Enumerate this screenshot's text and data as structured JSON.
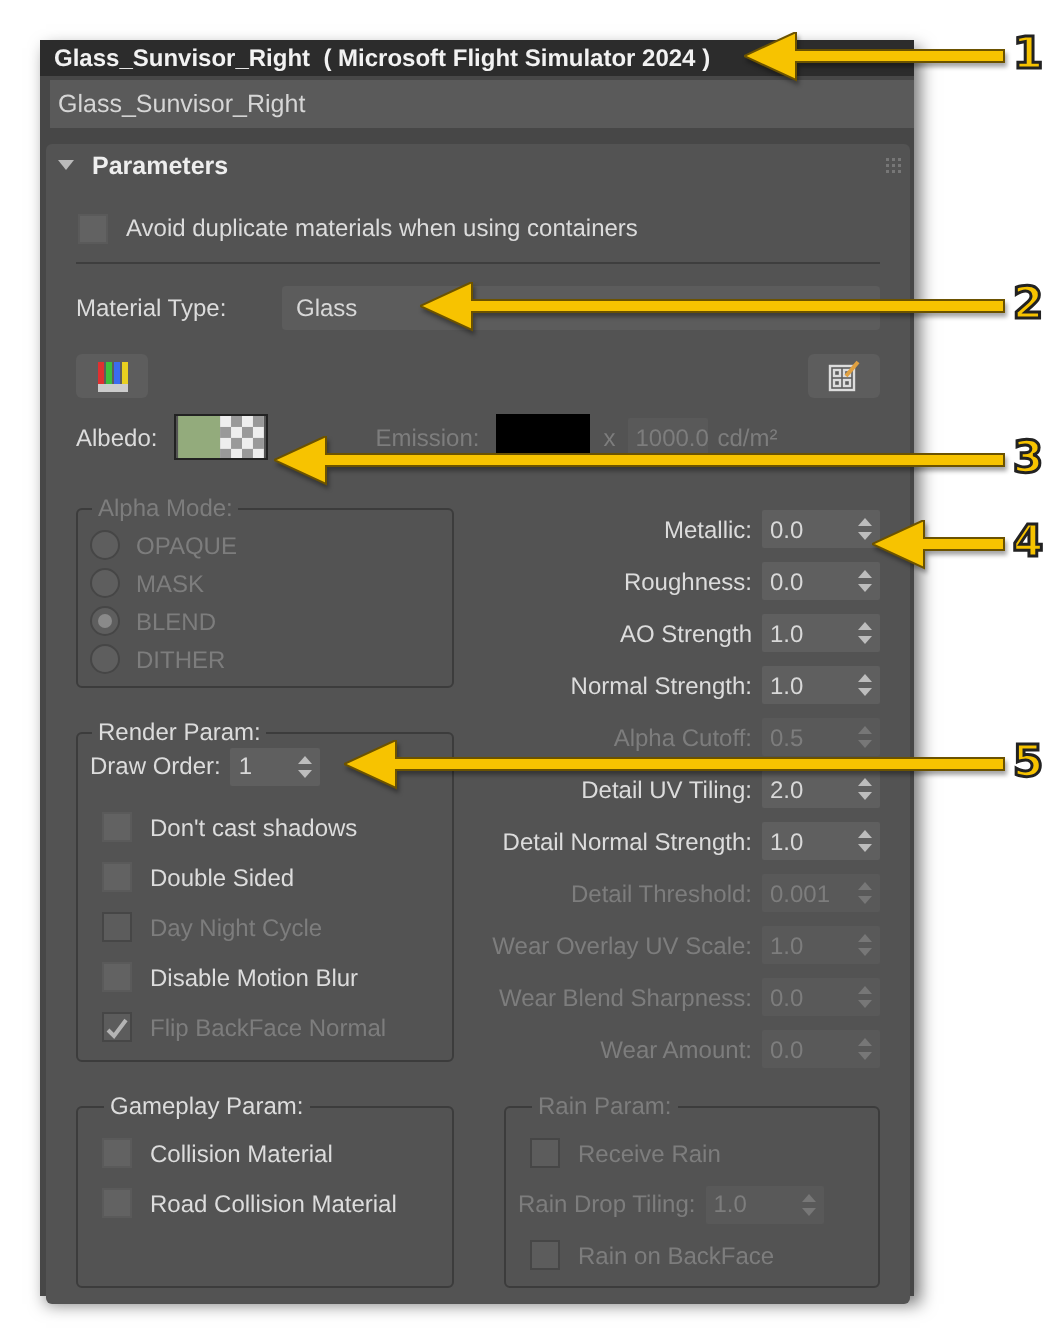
{
  "window": {
    "title": "Glass_Sunvisor_Right  ( Microsoft Flight Simulator 2024 )"
  },
  "name_field": {
    "value": "Glass_Sunvisor_Right"
  },
  "rollout": {
    "title": "Parameters",
    "expanded": true
  },
  "avoid_duplicates": {
    "label": "Avoid duplicate materials when using containers",
    "checked": false
  },
  "material_type": {
    "label": "Material Type:",
    "value": "Glass"
  },
  "albedo": {
    "label": "Albedo:"
  },
  "emission": {
    "label": "Emission:",
    "multiplier": "x",
    "value": "1000.0",
    "unit": "cd/m²",
    "disabled": true
  },
  "alpha_mode": {
    "label": "Alpha Mode:",
    "disabled": true,
    "options": [
      {
        "label": "OPAQUE",
        "selected": false
      },
      {
        "label": "MASK",
        "selected": false
      },
      {
        "label": "BLEND",
        "selected": true
      },
      {
        "label": "DITHER",
        "selected": false
      }
    ]
  },
  "render_param": {
    "label": "Render Param:",
    "draw_order": {
      "label": "Draw Order:",
      "value": "1"
    },
    "options": [
      {
        "label": "Don't cast shadows",
        "checked": false,
        "disabled": false
      },
      {
        "label": "Double Sided",
        "checked": false,
        "disabled": false
      },
      {
        "label": "Day Night Cycle",
        "checked": false,
        "disabled": true
      },
      {
        "label": "Disable Motion Blur",
        "checked": false,
        "disabled": false
      },
      {
        "label": "Flip BackFace Normal",
        "checked": true,
        "disabled": true
      }
    ]
  },
  "properties": [
    {
      "label": "Metallic:",
      "value": "0.0",
      "disabled": false
    },
    {
      "label": "Roughness:",
      "value": "0.0",
      "disabled": false
    },
    {
      "label": "AO Strength",
      "value": "1.0",
      "disabled": false
    },
    {
      "label": "Normal Strength:",
      "value": "1.0",
      "disabled": false
    },
    {
      "label": "Alpha Cutoff:",
      "value": "0.5",
      "disabled": true
    },
    {
      "label": "Detail UV Tiling:",
      "value": "2.0",
      "disabled": false
    },
    {
      "label": "Detail Normal Strength:",
      "value": "1.0",
      "disabled": false
    },
    {
      "label": "Detail Threshold:",
      "value": "0.001",
      "disabled": true
    },
    {
      "label": "Wear Overlay UV Scale:",
      "value": "1.0",
      "disabled": true
    },
    {
      "label": "Wear Blend Sharpness:",
      "value": "0.0",
      "disabled": true
    },
    {
      "label": "Wear Amount:",
      "value": "0.0",
      "disabled": true
    }
  ],
  "gameplay_param": {
    "label": "Gameplay Param:",
    "options": [
      {
        "label": "Collision Material",
        "checked": false
      },
      {
        "label": "Road Collision Material",
        "checked": false
      }
    ]
  },
  "rain_param": {
    "label": "Rain Param:",
    "disabled": true,
    "items": [
      {
        "kind": "checkbox",
        "label": "Receive Rain",
        "checked": false
      },
      {
        "kind": "spinner",
        "label": "Rain Drop Tiling:",
        "value": "1.0"
      },
      {
        "kind": "checkbox",
        "label": "Rain on BackFace",
        "checked": false
      }
    ]
  },
  "callouts": [
    {
      "number": "1"
    },
    {
      "number": "2"
    },
    {
      "number": "3"
    },
    {
      "number": "4"
    },
    {
      "number": "5"
    }
  ]
}
